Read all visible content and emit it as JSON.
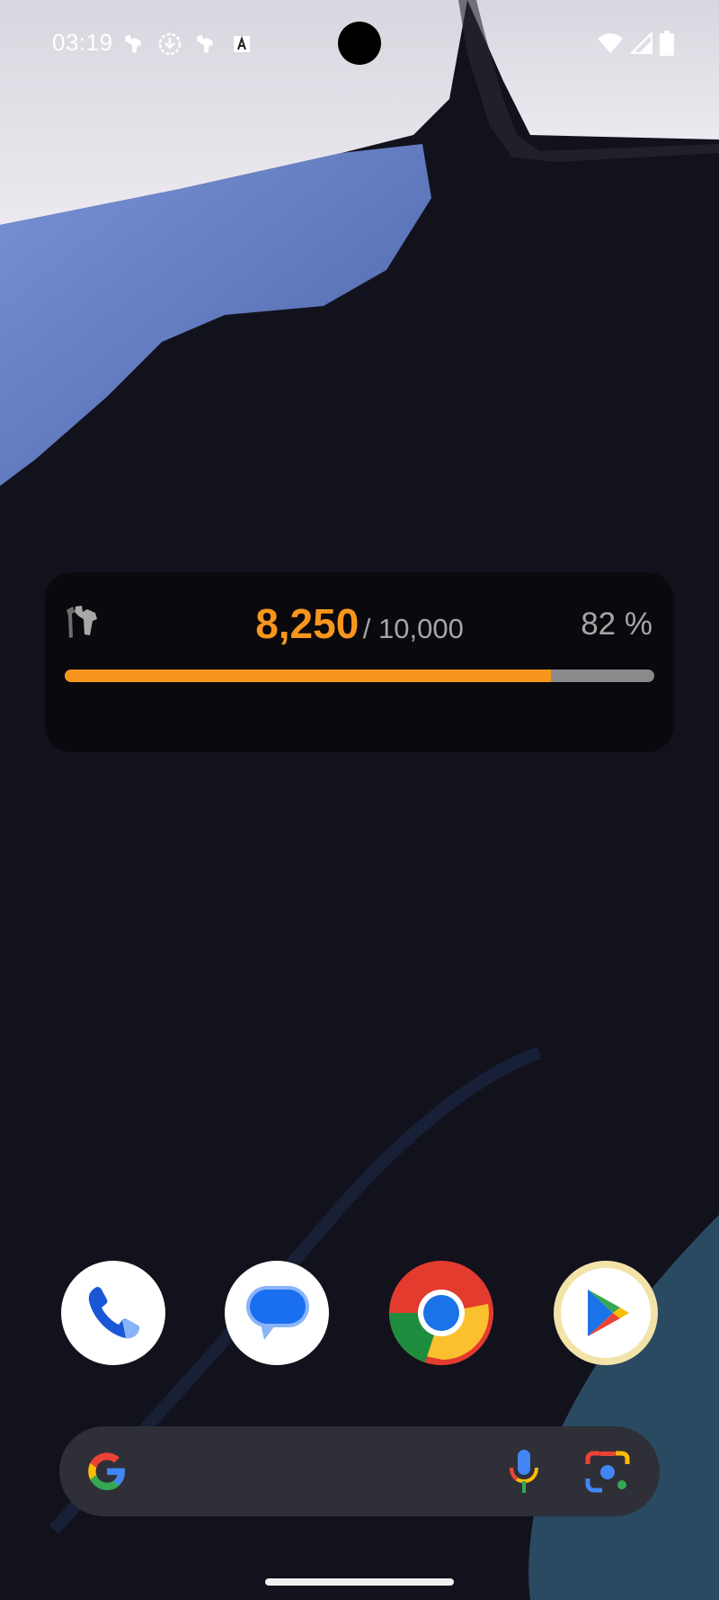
{
  "status_bar": {
    "time": "03:19",
    "notification_icons": [
      "shoe-icon",
      "download-icon",
      "shoe-icon",
      "font-icon"
    ],
    "system_icons": [
      "wifi-icon",
      "signal-icon",
      "battery-icon"
    ]
  },
  "step_widget": {
    "steps": "8,250",
    "goal": "/ 10,000",
    "percent_label": "82 %",
    "progress_fraction": 0.825,
    "accent_color": "#f7961c",
    "track_color": "#8a8a8a"
  },
  "dock": {
    "apps": [
      "phone-app",
      "messages-app",
      "chrome-app",
      "play-store-app"
    ]
  },
  "search_bar": {
    "icons": [
      "google-logo",
      "mic-icon",
      "lens-icon"
    ]
  }
}
